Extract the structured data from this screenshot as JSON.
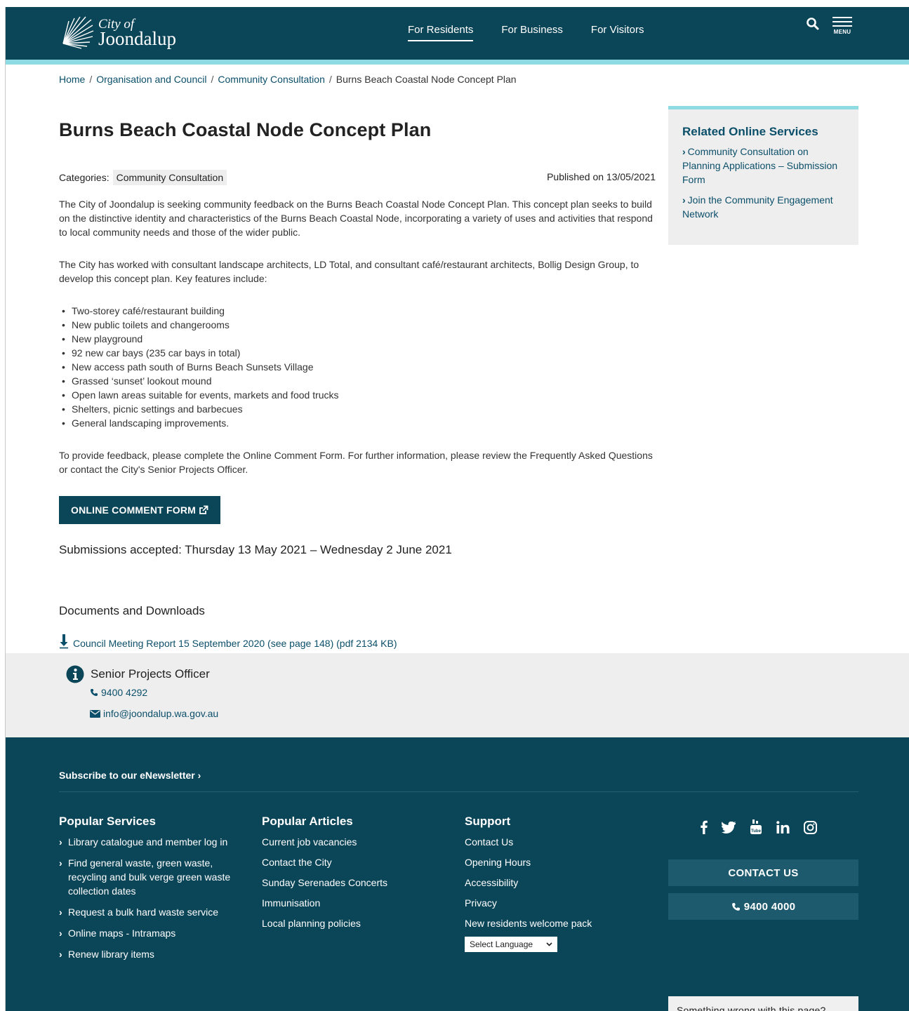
{
  "header": {
    "logo_small": "City of",
    "logo_big": "Joondalup",
    "nav": [
      "For Residents",
      "For Business",
      "For Visitors"
    ],
    "menu_label": "MENU"
  },
  "breadcrumb": [
    "Home",
    "Organisation and Council",
    "Community Consultation",
    "Burns Beach Coastal Node Concept Plan"
  ],
  "main": {
    "title": "Burns Beach Coastal Node Concept Plan",
    "categories_label": "Categories:",
    "category": "Community Consultation",
    "published": "Published on 13/05/2021",
    "para1": "The City of Joondalup is seeking community feedback on the Burns Beach Coastal Node Concept Plan. This concept plan seeks to build on the distinctive identity and characteristics of the Burns Beach Coastal Node, incorporating a variety of uses and activities that respond to local community needs and those of the wider public.",
    "para2": "The City has worked with consultant landscape architects, LD Total, and consultant café/restaurant architects, Bollig Design Group, to develop this concept plan. Key features include:",
    "features": [
      "Two-storey café/restaurant building",
      "New public toilets and changerooms",
      "New playground",
      "92 new car bays (235 car bays in total)",
      "New access path south of Burns Beach Sunsets Village",
      "Grassed ‘sunset’ lookout mound",
      "Open lawn areas suitable for events, markets and food trucks",
      "Shelters, picnic settings and barbecues",
      "General landscaping improvements."
    ],
    "para3": "To provide feedback, please complete the Online Comment Form. For further information, please review the Frequently Asked Questions or contact the City's Senior Projects Officer.",
    "cta_label": "ONLINE COMMENT FORM",
    "submissions": "Submissions accepted: Thursday 13 May 2021 – Wednesday 2 June 2021",
    "docs_heading": "Documents and Downloads",
    "doc_link": "Council Meeting Report 15 September 2020 (see page 148) (pdf 2134 KB)"
  },
  "sidebar": {
    "title": "Related Online Services",
    "links": [
      "Community Consultation on Planning Applications – Submission Form",
      "Join the Community Engagement Network"
    ]
  },
  "contact": {
    "title": "Senior Projects Officer",
    "phone": "9400 4292",
    "email": "info@joondalup.wa.gov.au"
  },
  "footer": {
    "subscribe": "Subscribe to our eNewsletter",
    "popular_services": {
      "title": "Popular Services",
      "links": [
        "Library catalogue and member log in",
        "Find general waste, green waste, recycling and bulk verge green waste collection dates",
        "Request a bulk hard waste service",
        "Online maps - Intramaps",
        "Renew library items"
      ]
    },
    "popular_articles": {
      "title": "Popular Articles",
      "links": [
        "Current job vacancies",
        "Contact the City",
        "Sunday Serenades Concerts",
        "Immunisation",
        "Local planning policies"
      ]
    },
    "support": {
      "title": "Support",
      "links": [
        "Contact Us",
        "Opening Hours",
        "Accessibility",
        "Privacy",
        "New residents welcome pack"
      ],
      "language_select": "Select Language"
    },
    "social_icons": [
      "facebook-icon",
      "twitter-icon",
      "youtube-icon",
      "linkedin-icon",
      "instagram-icon"
    ],
    "contact_button": "CONTACT US",
    "phone_button": "9400 4000",
    "feedback_button": "Something wrong with this page?"
  },
  "colors": {
    "brand_dark": "#0b4558",
    "accent_cyan": "#8fdbe3",
    "link": "#0b4f6a",
    "panel_gray": "#eeeeee"
  }
}
